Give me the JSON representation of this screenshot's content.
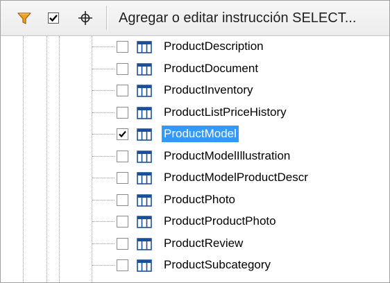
{
  "toolbar": {
    "filter_icon": "filter-icon",
    "check_icon": "checkbox-icon",
    "target_icon": "crosshair-icon",
    "title": "Agregar o editar instrucción SELECT..."
  },
  "colors": {
    "filter": "#f0a020",
    "selection": "#3399ff",
    "table_icon": "#1a4f9c"
  },
  "tree": {
    "items": [
      {
        "label": "ProductDescription",
        "checked": false,
        "selected": false
      },
      {
        "label": "ProductDocument",
        "checked": false,
        "selected": false
      },
      {
        "label": "ProductInventory",
        "checked": false,
        "selected": false
      },
      {
        "label": "ProductListPriceHistory",
        "checked": false,
        "selected": false
      },
      {
        "label": "ProductModel",
        "checked": true,
        "selected": true
      },
      {
        "label": "ProductModelIllustration",
        "checked": false,
        "selected": false
      },
      {
        "label": "ProductModelProductDescr",
        "checked": false,
        "selected": false
      },
      {
        "label": "ProductPhoto",
        "checked": false,
        "selected": false
      },
      {
        "label": "ProductProductPhoto",
        "checked": false,
        "selected": false
      },
      {
        "label": "ProductReview",
        "checked": false,
        "selected": false
      },
      {
        "label": "ProductSubcategory",
        "checked": false,
        "selected": false
      }
    ]
  }
}
